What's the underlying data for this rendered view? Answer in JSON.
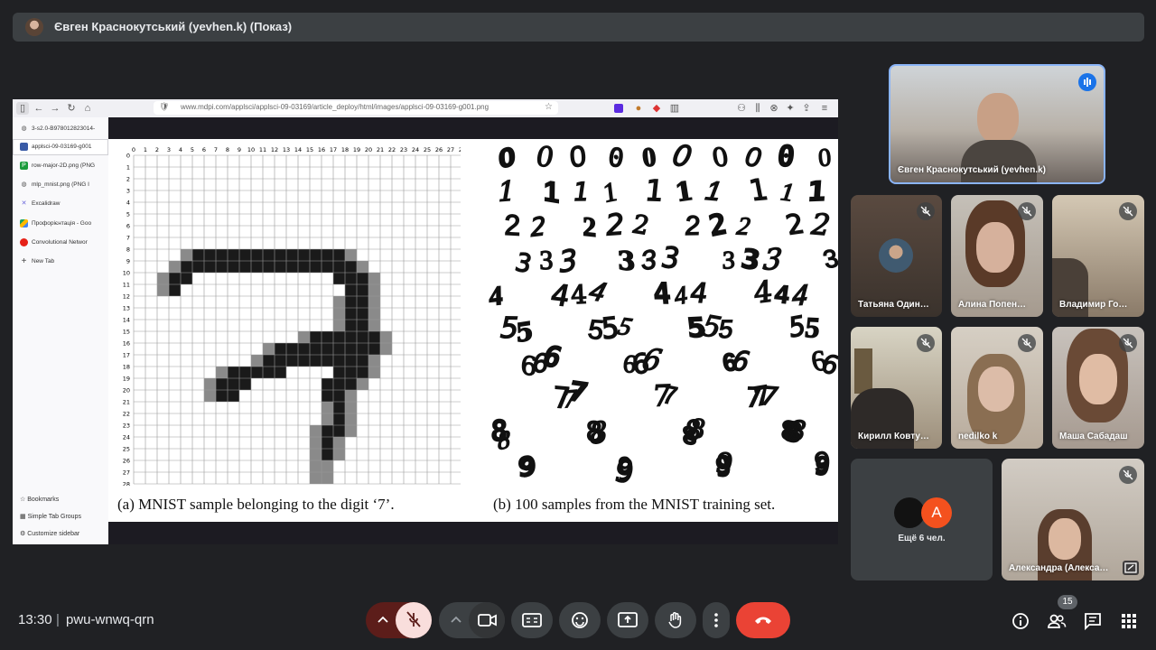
{
  "header": {
    "presenter_title": "Євген Краснокутський (yevhen.k) (Показ)"
  },
  "browser": {
    "url": "www.mdpi.com/applsci/applsci-09-03169/article_deploy/html/images/applsci-09-03169-g001.png",
    "tabs": [
      {
        "label": "3-s2.0-B978012823014-",
        "icon": "globe-icon"
      },
      {
        "label": "applsci-09-03169-g001",
        "icon": "mdpi-icon",
        "active": true
      },
      {
        "label": "row-major-2D.png (PNG",
        "icon": "image-icon"
      },
      {
        "label": "mlp_mnist.png (PNG I",
        "icon": "globe-icon"
      },
      {
        "label": "Excalidraw",
        "icon": "excalidraw-icon"
      },
      {
        "label": "Профорієнтація - Goo",
        "icon": "drive-icon"
      },
      {
        "label": "Convolutional Networ",
        "icon": "youtube-icon"
      },
      {
        "label": "New Tab",
        "icon": "plus-icon"
      }
    ],
    "bottom_items": [
      "Bookmarks",
      "Simple Tab Groups",
      "Customize sidebar"
    ]
  },
  "figure": {
    "caption_a": "(a) MNIST sample belonging to the digit ‘7’.",
    "caption_b": "(b) 100 samples from the MNIST training set.",
    "axis_labels": [
      "0",
      "1",
      "2",
      "3",
      "4",
      "5",
      "6",
      "7",
      "8",
      "9",
      "10",
      "11",
      "12",
      "13",
      "14",
      "15",
      "16",
      "17",
      "18",
      "19",
      "20",
      "21",
      "22",
      "23",
      "24",
      "25",
      "26",
      "27",
      "28"
    ],
    "digit_rows": [
      "0",
      "1",
      "2",
      "3",
      "4",
      "5",
      "6",
      "7",
      "8",
      "9"
    ]
  },
  "participants": {
    "main": {
      "name": "Євген Краснокутський (yevhen.k)"
    },
    "tiles": [
      {
        "name": "Татьяна Один…"
      },
      {
        "name": "Алина Попен…"
      },
      {
        "name": "Владимир Го…"
      },
      {
        "name": "Кирилл Ковту…"
      },
      {
        "name": "nedilko k"
      },
      {
        "name": "Маша Сабадаш"
      },
      {
        "name": "Александра (Алекса…"
      }
    ],
    "more": {
      "label": "Ещё 6 чел.",
      "avatar_letter": "A",
      "avatar_color": "#f4511e"
    }
  },
  "controls": {
    "time": "13:30",
    "separator": "|",
    "meeting_code": "pwu-wnwq-qrn",
    "people_count": "15",
    "mic_off_color": "#f9dedc",
    "end_call_color": "#ea4335"
  }
}
